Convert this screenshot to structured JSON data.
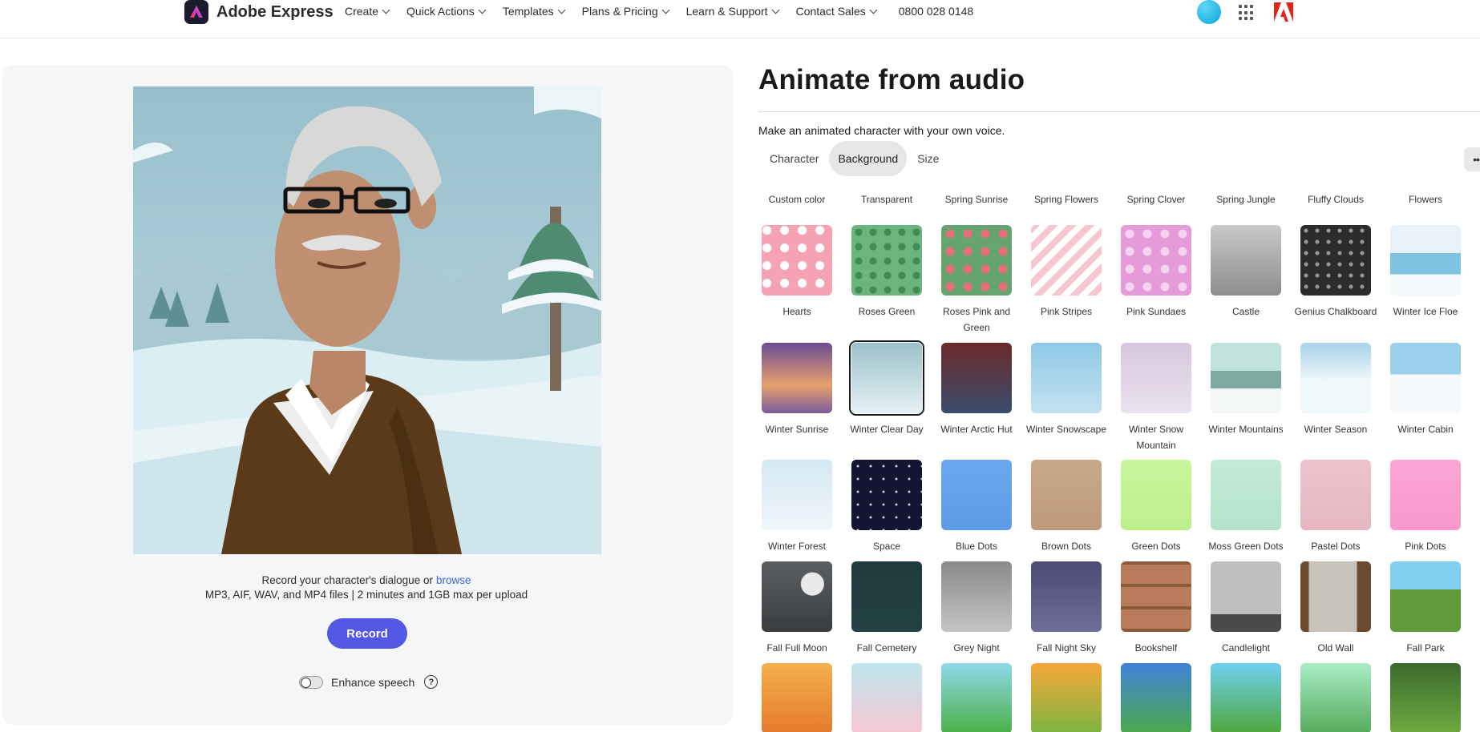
{
  "nav": {
    "brand": "Adobe Express",
    "menu": [
      {
        "label": "Create"
      },
      {
        "label": "Quick Actions"
      },
      {
        "label": "Templates"
      },
      {
        "label": "Plans & Pricing"
      },
      {
        "label": "Learn & Support"
      },
      {
        "label": "Contact Sales"
      }
    ],
    "phone": "0800 028 0148"
  },
  "left": {
    "record_prompt": "Record your character's dialogue or",
    "browse_label": "browse",
    "formats": "MP3, AIF, WAV, and MP4 files | 2 minutes and 1GB max per upload",
    "record_button": "Record",
    "enhance_label": "Enhance speech",
    "help_glyph": "?"
  },
  "right": {
    "title": "Animate from audio",
    "subtitle": "Make an animated character with your own voice.",
    "tabs": [
      "Character",
      "Background",
      "Size"
    ],
    "active_tab": "Background",
    "more_glyph": "••"
  },
  "backgrounds": {
    "row0": [
      "Custom color",
      "Transparent",
      "Spring Sunrise",
      "Spring Flowers",
      "Spring Clover",
      "Spring Jungle",
      "Fluffy Clouds",
      "Flowers"
    ],
    "row1": [
      "Hearts",
      "Roses Green",
      "Roses Pink and Green",
      "Pink Stripes",
      "Pink Sundaes",
      "Castle",
      "Genius Chalkboard",
      "Winter Ice Floe"
    ],
    "row2": [
      "Winter Sunrise",
      "Winter Clear Day",
      "Winter Arctic Hut",
      "Winter Snowscape",
      "Winter Snow Mountain",
      "Winter Mountains",
      "Winter Season",
      "Winter Cabin"
    ],
    "row3": [
      "Winter Forest",
      "Space",
      "Blue Dots",
      "Brown Dots",
      "Green Dots",
      "Moss Green Dots",
      "Pastel Dots",
      "Pink Dots"
    ],
    "row4": [
      "Fall Full Moon",
      "Fall Cemetery",
      "Grey Night",
      "Fall Night Sky",
      "Bookshelf",
      "Candlelight",
      "Old Wall",
      "Fall Park"
    ],
    "selected": "Winter Clear Day"
  }
}
